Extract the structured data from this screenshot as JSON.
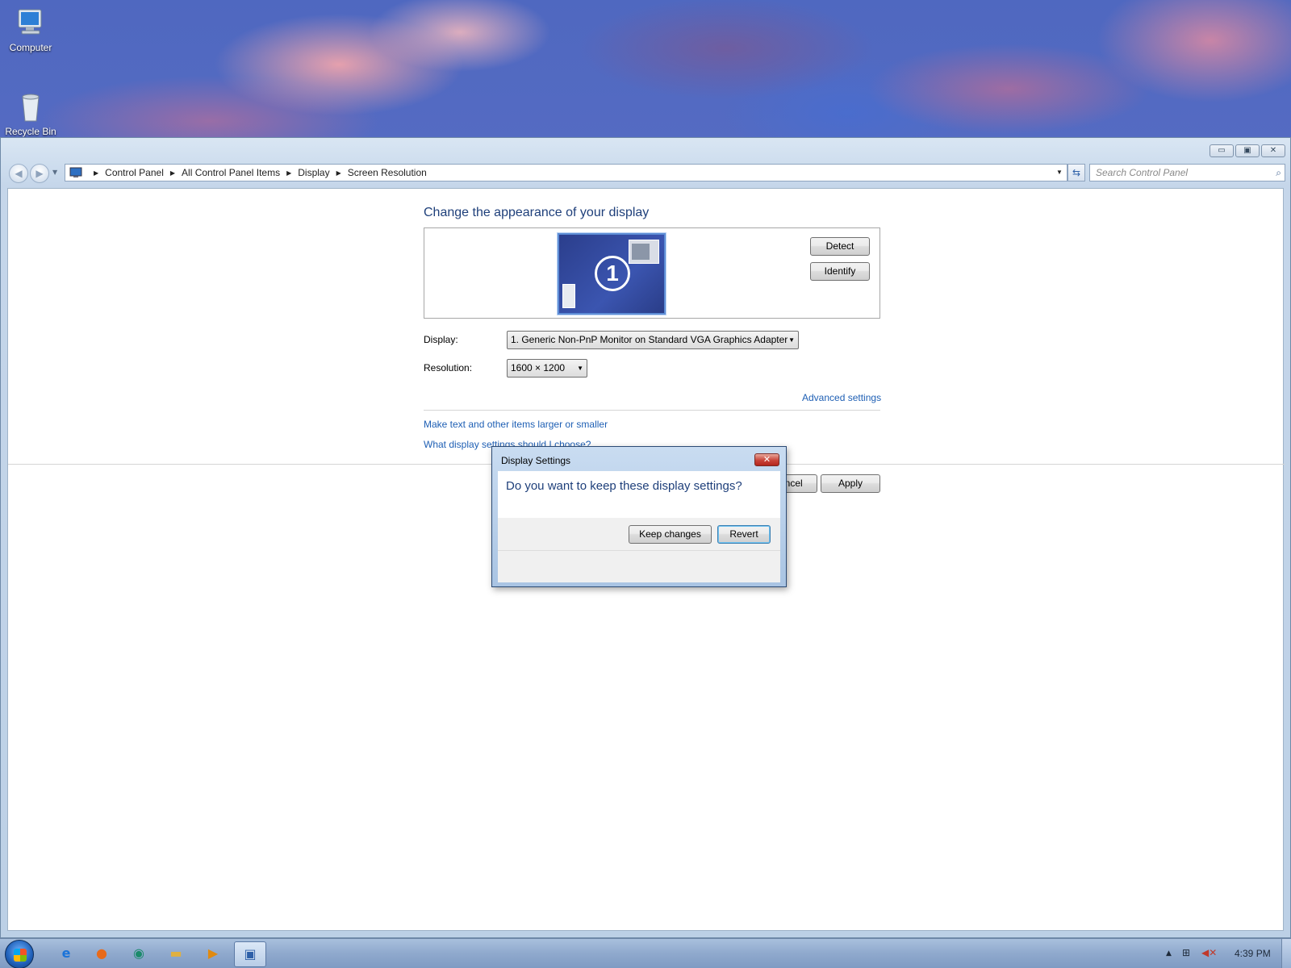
{
  "desktop": {
    "icons": [
      {
        "label": "Computer",
        "icon": "computer-icon"
      },
      {
        "label": "Recycle Bin",
        "icon": "recycle-bin-icon"
      }
    ]
  },
  "window": {
    "controls": {
      "minimize": "▭",
      "maximize": "▣",
      "close": "✕"
    },
    "nav": {
      "back_icon": "back-arrow-icon",
      "forward_icon": "forward-arrow-icon"
    },
    "breadcrumb": [
      "Control Panel",
      "All Control Panel Items",
      "Display",
      "Screen Resolution"
    ],
    "search": {
      "placeholder": "Search Control Panel"
    }
  },
  "main": {
    "heading": "Change the appearance of your display",
    "monitor_number": "1",
    "detect_label": "Detect",
    "identify_label": "Identify",
    "display_label": "Display:",
    "display_value": "1. Generic Non-PnP Monitor on Standard VGA Graphics Adapter",
    "resolution_label": "Resolution:",
    "resolution_value": "1600 × 1200",
    "advanced_link": "Advanced settings",
    "text_size_link": "Make text and other items larger or smaller",
    "what_display_link": "What display settings should I choose?",
    "cancel_label": "Cancel",
    "apply_label": "Apply"
  },
  "dialog": {
    "title": "Display Settings",
    "question": "Do you want to keep these display settings?",
    "keep_label": "Keep changes",
    "revert_label": "Revert"
  },
  "taskbar": {
    "apps": [
      "internet-explorer-icon",
      "firefox-icon",
      "app-icon",
      "file-explorer-icon",
      "media-player-icon",
      "control-panel-icon"
    ],
    "clock": "4:39 PM"
  }
}
